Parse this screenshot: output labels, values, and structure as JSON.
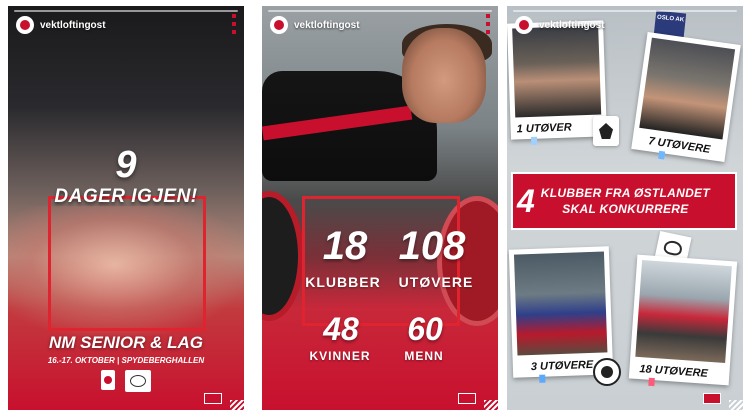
{
  "account": {
    "handle": "vektloftingost"
  },
  "stories": [
    {
      "countdown_number": "9",
      "countdown_text": "DAGER IGJEN!",
      "event_title": "NM SENIOR & LAG",
      "event_date": "16.-17. OKTOBER | SPYDEBERGHALLEN"
    },
    {
      "stats": [
        {
          "value": "18",
          "label": "KLUBBER"
        },
        {
          "value": "108",
          "label": "UTØVERE"
        },
        {
          "value": "48",
          "label": "KVINNER"
        },
        {
          "value": "60",
          "label": "MENN"
        }
      ]
    },
    {
      "clubs": [
        {
          "count": "1 UTØVER"
        },
        {
          "count": "7 UTØVERE"
        },
        {
          "count": "3 UTØVERE"
        },
        {
          "count": "18 UTØVERE"
        }
      ],
      "banner_number": "4",
      "banner_line1": "KLUBBER FRA ØSTLANDET",
      "banner_line2": "SKAL KONKURRERE",
      "badge_top": "OSLO AK"
    }
  ],
  "colors": {
    "brand_red": "#c8102e",
    "frame_red": "#e0242f",
    "light_blue_tag": "#9fd0ff"
  }
}
